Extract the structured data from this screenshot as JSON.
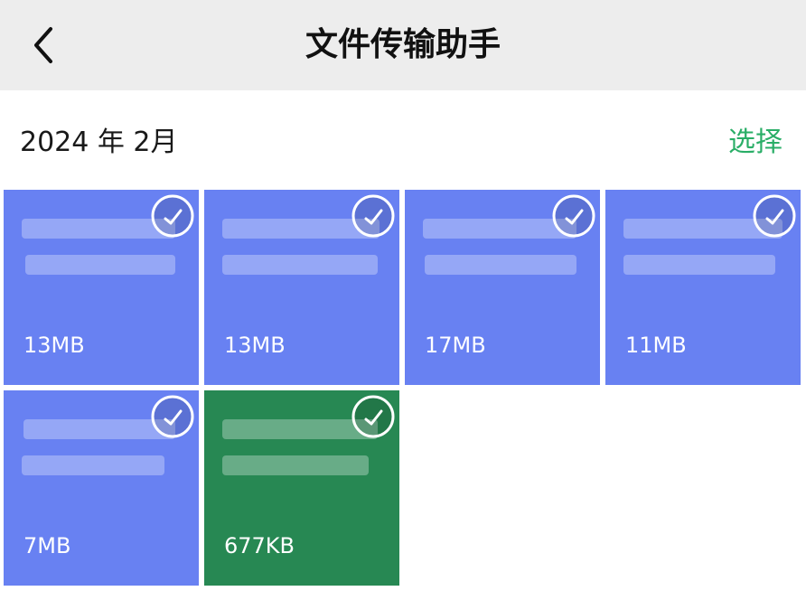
{
  "navbar": {
    "back_icon": "chevron-left-icon",
    "title": "文件传输助手"
  },
  "section": {
    "month": "2024 年 2月",
    "select_label": "选择",
    "accent_color": "#2aae67"
  },
  "files": [
    {
      "size": "13MB",
      "color": "#6881f2",
      "check_icon": "check-circle-icon"
    },
    {
      "size": "13MB",
      "color": "#6881f2",
      "check_icon": "check-circle-icon"
    },
    {
      "size": "17MB",
      "color": "#6881f2",
      "check_icon": "check-circle-icon"
    },
    {
      "size": "11MB",
      "color": "#6881f2",
      "check_icon": "check-circle-icon"
    },
    {
      "size": "7MB",
      "color": "#6881f2",
      "check_icon": "check-circle-icon"
    },
    {
      "size": "677KB",
      "color": "#278853",
      "check_icon": "check-circle-icon"
    }
  ]
}
